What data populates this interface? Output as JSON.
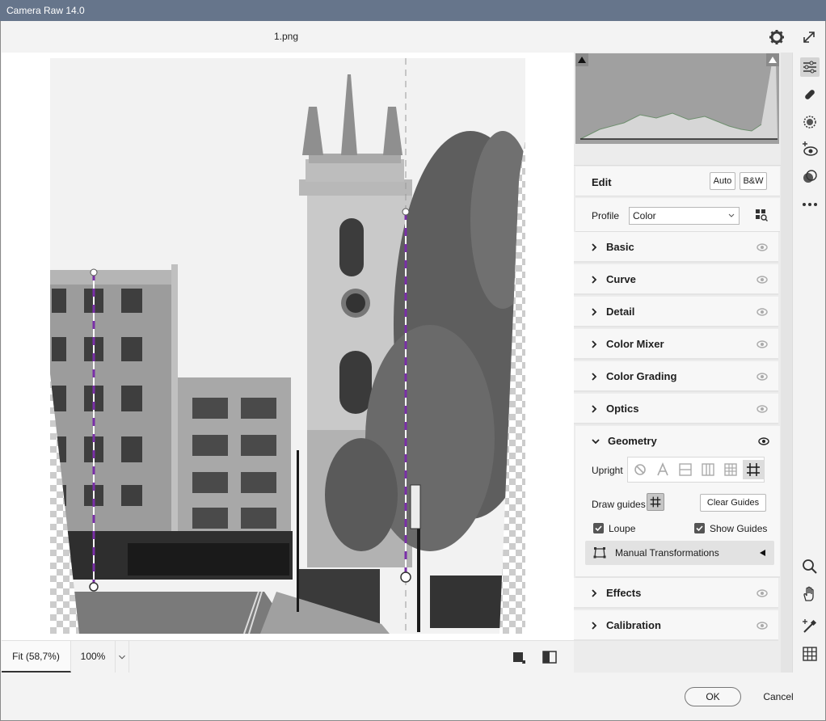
{
  "window": {
    "title": "Camera Raw 14.0"
  },
  "header": {
    "filename": "1.png"
  },
  "bottombar": {
    "fit_label": "Fit (58,7%)",
    "zoom_label": "100%"
  },
  "edit": {
    "title": "Edit",
    "auto_label": "Auto",
    "bw_label": "B&W",
    "profile_label": "Profile",
    "profile_value": "Color"
  },
  "sections": {
    "basic": "Basic",
    "curve": "Curve",
    "detail": "Detail",
    "color_mixer": "Color Mixer",
    "color_grading": "Color Grading",
    "optics": "Optics",
    "geometry": "Geometry",
    "effects": "Effects",
    "calibration": "Calibration"
  },
  "geometry": {
    "upright_label": "Upright",
    "draw_guides_label": "Draw guides",
    "clear_guides_label": "Clear Guides",
    "loupe_label": "Loupe",
    "show_guides_label": "Show Guides",
    "manual_label": "Manual Transformations",
    "loupe_checked": true,
    "show_guides_checked": true
  },
  "dialog": {
    "ok_label": "OK",
    "cancel_label": "Cancel"
  },
  "colors": {
    "titlebar": "#66758b",
    "guide": "#7a2fa8"
  }
}
